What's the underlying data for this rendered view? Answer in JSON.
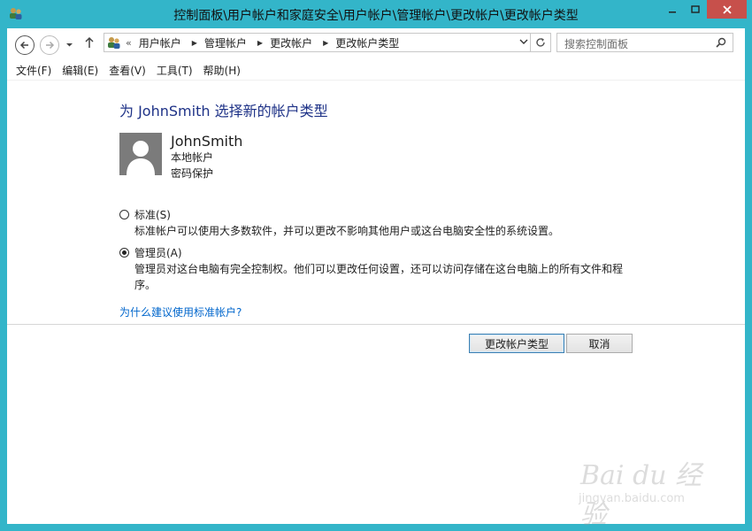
{
  "window": {
    "title": "控制面板\\用户帐户和家庭安全\\用户帐户\\管理帐户\\更改帐户\\更改帐户类型",
    "accent_color": "#33b5c9",
    "close_color": "#c7504b"
  },
  "navbar": {
    "breadcrumb_overflow": "«",
    "breadcrumbs": [
      "用户帐户",
      "管理帐户",
      "更改帐户",
      "更改帐户类型"
    ],
    "search_placeholder": "搜索控制面板"
  },
  "menu": [
    "文件(F)",
    "编辑(E)",
    "查看(V)",
    "工具(T)",
    "帮助(H)"
  ],
  "main": {
    "heading": "为 JohnSmith 选择新的帐户类型",
    "user": {
      "name": "JohnSmith",
      "type": "本地帐户",
      "protection": "密码保护"
    },
    "options": [
      {
        "label": "标准(S)",
        "description": "标准帐户可以使用大多数软件，并可以更改不影响其他用户或这台电脑安全性的系统设置。",
        "selected": false
      },
      {
        "label": "管理员(A)",
        "description": "管理员对这台电脑有完全控制权。他们可以更改任何设置，还可以访问存储在这台电脑上的所有文件和程序。",
        "selected": true
      }
    ],
    "help_link": "为什么建议使用标准帐户?",
    "buttons": {
      "confirm": "更改帐户类型",
      "cancel": "取消"
    }
  },
  "watermark": {
    "brand": "Bai du 经验",
    "url": "jingyan.baidu.com"
  }
}
